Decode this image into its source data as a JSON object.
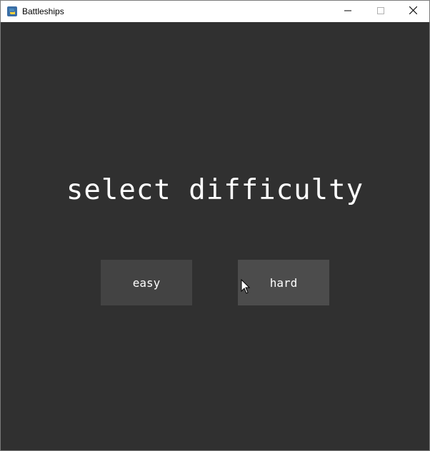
{
  "window": {
    "title": "Battleships",
    "app_icon": "python-icon",
    "controls": {
      "minimize_icon": "minimize-icon",
      "maximize_icon": "maximize-icon",
      "close_icon": "close-icon"
    }
  },
  "screen": {
    "heading": "select difficulty",
    "buttons": {
      "easy_label": "easy",
      "hard_label": "hard"
    },
    "cursor_icon": "mouse-pointer-icon"
  },
  "colors": {
    "background": "#303030",
    "button_easy": "#434343",
    "button_hard_hover": "#4c4c4c",
    "text": "#ffffff"
  }
}
